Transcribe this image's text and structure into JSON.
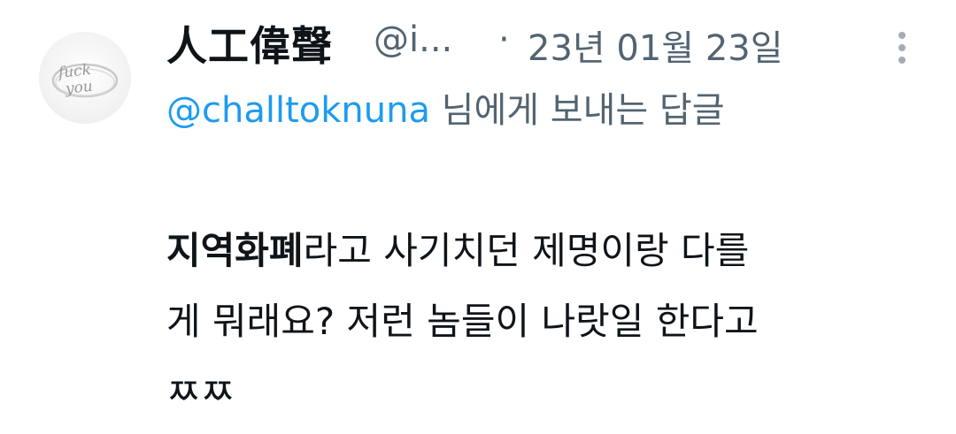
{
  "author": {
    "display_name": "人工偉聲",
    "handle": "@i...",
    "separator": "·",
    "timestamp": "23년 01월 23일",
    "avatar_text": "fuck you"
  },
  "reply": {
    "mention": "@challtoknuna",
    "suffix": " 님에게 보내는 답글"
  },
  "tweet": {
    "bold_part": "지역화폐",
    "text_line1": "라고 사기치던 제명이랑 다를",
    "text_line2": "게 뭐래요?  저런 놈들이 나랏일 한다고",
    "text_line3": "ㅉㅉ"
  },
  "colors": {
    "text": "#0f1419",
    "secondary": "#536471",
    "link": "#1d9bf0"
  },
  "icons": {
    "more": "more-vertical-icon"
  }
}
